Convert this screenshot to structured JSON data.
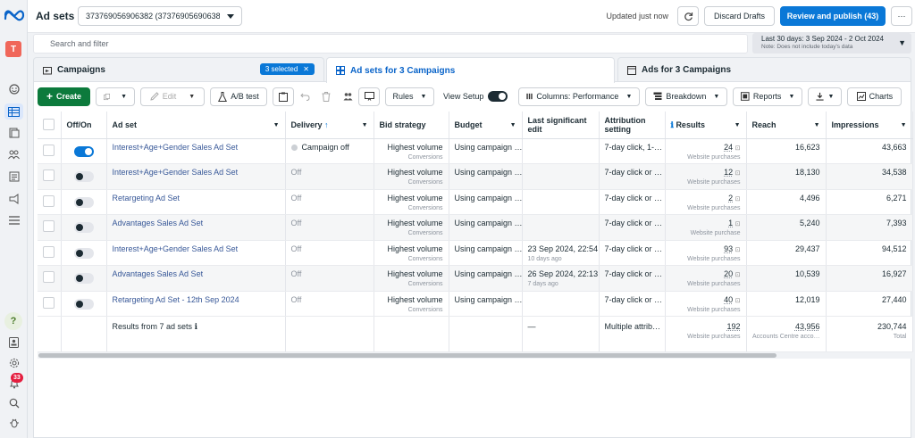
{
  "app": {
    "title": "Ad sets",
    "account": "373769056906382 (37376905690638…"
  },
  "header": {
    "updated": "Updated just now",
    "discard": "Discard Drafts",
    "publish": "Review and publish (43)",
    "more": "···"
  },
  "search": {
    "placeholder": "Search and filter"
  },
  "date_range": {
    "label": "Last 30 days: 3 Sep 2024 - 2 Oct 2024",
    "note": "Note: Does not include today's data"
  },
  "tabs": {
    "campaigns": "Campaigns",
    "selected_chip": "3 selected",
    "adsets": "Ad sets for 3 Campaigns",
    "ads": "Ads for 3 Campaigns"
  },
  "toolbar": {
    "create": "Create",
    "edit": "Edit",
    "ab_test": "A/B test",
    "rules": "Rules",
    "view_setup": "View Setup",
    "columns": "Columns: Performance",
    "breakdown": "Breakdown",
    "reports": "Reports",
    "charts": "Charts"
  },
  "columns": [
    "Off/On",
    "Ad set",
    "Delivery",
    "Bid strategy",
    "Budget",
    "Last significant edit",
    "Attribution setting",
    "Results",
    "Reach",
    "Impressions"
  ],
  "rows": [
    {
      "on": true,
      "name": "Interest+Age+Gender Sales Ad Set",
      "delivery": "Campaign off",
      "bid": "Highest volume",
      "bid_sub": "Conversions",
      "budget": "Using campaign …",
      "edit": "",
      "edit_sub": "",
      "attr": "7-day click, 1-…",
      "results": "24",
      "results_sub": "Website purchases",
      "reach": "16,623",
      "impr": "43,663"
    },
    {
      "on": false,
      "name": "Interest+Age+Gender Sales Ad Set",
      "delivery": "Off",
      "bid": "Highest volume",
      "bid_sub": "Conversions",
      "budget": "Using campaign …",
      "edit": "",
      "edit_sub": "",
      "attr": "7-day click or …",
      "results": "12",
      "results_sub": "Website purchases",
      "reach": "18,130",
      "impr": "34,538"
    },
    {
      "on": false,
      "name": "Retargeting Ad Set",
      "delivery": "Off",
      "bid": "Highest volume",
      "bid_sub": "Conversions",
      "budget": "Using campaign …",
      "edit": "",
      "edit_sub": "",
      "attr": "7-day click or …",
      "results": "2",
      "results_sub": "Website purchases",
      "reach": "4,496",
      "impr": "6,271"
    },
    {
      "on": false,
      "name": "Advantages Sales Ad Set",
      "delivery": "Off",
      "bid": "Highest volume",
      "bid_sub": "Conversions",
      "budget": "Using campaign …",
      "edit": "",
      "edit_sub": "",
      "attr": "7-day click or …",
      "results": "1",
      "results_sub": "Website purchase",
      "reach": "5,240",
      "impr": "7,393"
    },
    {
      "on": false,
      "name": "Interest+Age+Gender Sales Ad Set",
      "delivery": "Off",
      "bid": "Highest volume",
      "bid_sub": "Conversions",
      "budget": "Using campaign …",
      "edit": "23 Sep 2024, 22:54",
      "edit_sub": "10 days ago",
      "attr": "7-day click or …",
      "results": "93",
      "results_sub": "Website purchases",
      "reach": "29,437",
      "impr": "94,512"
    },
    {
      "on": false,
      "name": "Advantages Sales Ad Set",
      "delivery": "Off",
      "bid": "Highest volume",
      "bid_sub": "Conversions",
      "budget": "Using campaign …",
      "edit": "26 Sep 2024, 22:13",
      "edit_sub": "7 days ago",
      "attr": "7-day click or …",
      "results": "20",
      "results_sub": "Website purchases",
      "reach": "10,539",
      "impr": "16,927"
    },
    {
      "on": false,
      "name": "Retargeting Ad Set - 12th Sep 2024",
      "delivery": "Off",
      "bid": "Highest volume",
      "bid_sub": "Conversions",
      "budget": "Using campaign …",
      "edit": "",
      "edit_sub": "",
      "attr": "7-day click or …",
      "results": "40",
      "results_sub": "Website purchases",
      "reach": "12,019",
      "impr": "27,440"
    }
  ],
  "summary": {
    "label": "Results from 7 ad sets",
    "edit": "—",
    "attr": "Multiple attrib…",
    "results": "192",
    "results_sub": "Website purchases",
    "reach": "43,956",
    "reach_sub": "Accounts Centre acco…",
    "impr": "230,744",
    "impr_sub": "Total"
  },
  "sidebar": {
    "avatar": "T",
    "notifications": "33",
    "help": "?"
  }
}
